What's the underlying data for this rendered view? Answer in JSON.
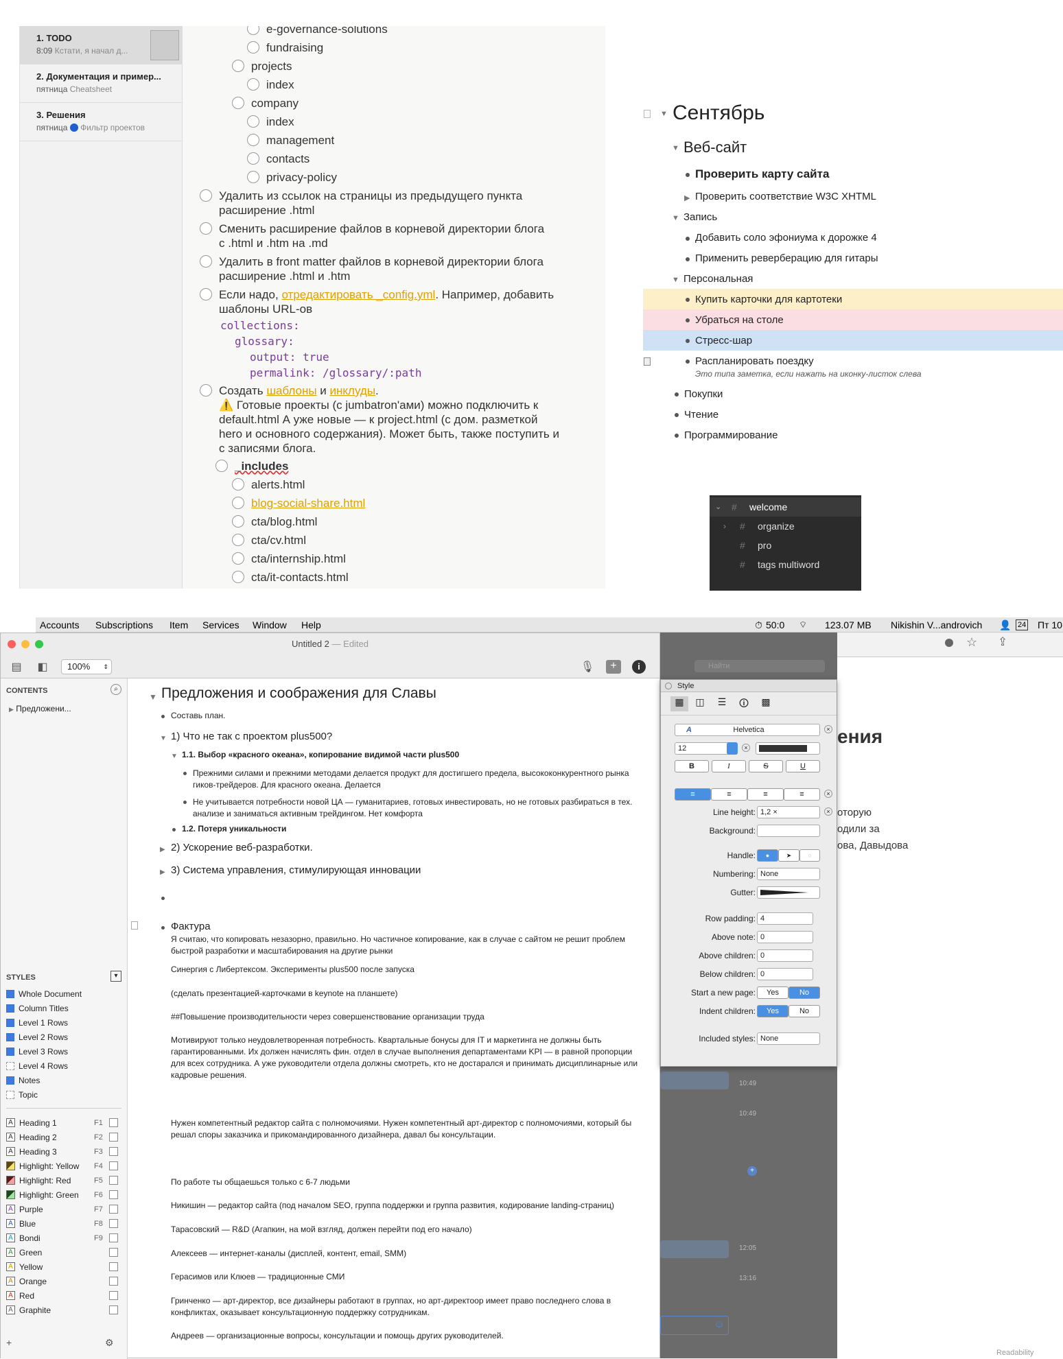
{
  "notes_app": {
    "notes": [
      {
        "title": "1. TODO",
        "date": "8:09",
        "preview": "Кстати, я начал д..."
      },
      {
        "title": "2. Документация и пример...",
        "date": "пятница",
        "preview": "Cheatsheet"
      },
      {
        "title": "3. Решения",
        "date": "пятница",
        "preview": "Фильтр проектов"
      }
    ],
    "tasks": {
      "t1": "e-governance-solutions",
      "t2": "fundraising",
      "t3": "projects",
      "t4": "index",
      "t5": "company",
      "t6": "index",
      "t7": "management",
      "t8": "contacts",
      "t9": "privacy-policy",
      "t10a": "Удалить из ссылок на страницы из предыдущего пункта",
      "t10b": "расширение .html",
      "t11a": "Сменить расширение файлов в корневой директории блога",
      "t11b": "с .html и .htm на .md",
      "t12a": "Удалить в front matter файлов  в корневой директории блога",
      "t12b": "расширение .html и .htm",
      "t13a_pre": "Если надо, ",
      "t13a_link": "отредактировать _config.yml",
      "t13a_post": ". Например, добавить",
      "t13b": "шаблоны URL-ов",
      "code1": "collections:",
      "code2": "glossary:",
      "code3": "output: true",
      "code4": "permalink: /glossary/:path",
      "t14_pre": "Создать ",
      "t14_link1": "шаблоны",
      "t14_mid": " и ",
      "t14_link2": "инклуды",
      "t14_end": ".",
      "warn1": "⚠️ Готовые проекты (с jumbatron'ами) можно подключить к",
      "warn2": "default.html  А уже новые — к project.html (с дом. разметкой",
      "warn3": "hero и основного содержания). Может быть, также поступить и",
      "warn4": "с записями блога.",
      "inc": "_includes",
      "f1": "alerts.html",
      "f2": "blog-social-share.html",
      "f3": "cta/blog.html",
      "f4": "cta/cv.html",
      "f5": "cta/internship.html",
      "f6": "cta/it-contacts.html"
    }
  },
  "outline": {
    "h1": "Сентябрь",
    "h2": "Веб-сайт",
    "i1": "Проверить карту сайта",
    "i2": "Проверить соответствие W3C XHTML",
    "g1": "Запись",
    "i3": "Добавить соло эфониума к дорожке 4",
    "i4": "Применить реверберацию для гитары",
    "g2": "Персональная",
    "i5": "Купить карточки для картотеки",
    "i6": "Убраться на столе",
    "i7": "Стресс-шар",
    "i8": "Распланировать поездку",
    "note": "Это типа заметка, если нажать на иконку-листок слева",
    "g3": "Покупки",
    "g4": "Чтение",
    "g5": "Программирование",
    "colors": {
      "yellow": "#fdf0c8",
      "red": "#fbdde4",
      "blue": "#cfe1f4"
    }
  },
  "tags": {
    "items": [
      "welcome",
      "organize",
      "pro",
      "tags multiword"
    ]
  },
  "menubar": {
    "items": [
      "Accounts",
      "Subscriptions",
      "Item",
      "Services",
      "Window",
      "Help"
    ],
    "timer": "50:0",
    "mem": "123.07 MB",
    "user": "Nikishin V...androvich",
    "cal": "24",
    "clock": "Пт 10"
  },
  "window": {
    "title": "Untitled 2",
    "edited": "— Edited",
    "zoom": "100%",
    "contents_label": "CONTENTS",
    "contents_item": "Предложени...",
    "styles_label": "STYLES",
    "styles": [
      "Whole Document",
      "Column Titles",
      "Level 1 Rows",
      "Level 2 Rows",
      "Level 3 Rows",
      "Level 4 Rows",
      "Notes",
      "Topic"
    ],
    "named_styles": [
      {
        "name": "Heading 1",
        "key": "F1"
      },
      {
        "name": "Heading 2",
        "key": "F2"
      },
      {
        "name": "Heading 3",
        "key": "F3"
      },
      {
        "name": "Highlight: Yellow",
        "key": "F4"
      },
      {
        "name": "Highlight: Red",
        "key": "F5"
      },
      {
        "name": "Highlight: Green",
        "key": "F6"
      },
      {
        "name": "Purple",
        "key": "F7"
      },
      {
        "name": "Blue",
        "key": "F8"
      },
      {
        "name": "Bondi",
        "key": "F9"
      },
      {
        "name": "Green",
        "key": ""
      },
      {
        "name": "Yellow",
        "key": ""
      },
      {
        "name": "Orange",
        "key": ""
      },
      {
        "name": "Red",
        "key": ""
      },
      {
        "name": "Graphite",
        "key": ""
      }
    ]
  },
  "document": {
    "title": "Предложения и соображения для Славы",
    "r1": "Составь план.",
    "r2": "1) Что не так с проектом plus500?",
    "r3": "1.1. Выбор «красного океана», копирование видимой части plus500",
    "r4a": "Прежними силами и прежними методами делается продукт для достигшего предела, высококонкурентного рынка",
    "r4b": "гиков-трейдеров.  Для красного океана. Делается",
    "r5a": "Не учитывается потребности новой ЦА — гуманитариев, готовых инвестировать, но не готовых разбираться в тех.",
    "r5b": "анализе и заниматься активным трейдингом. Нет комфорта",
    "r6": "1.2. Потеря уникальности",
    "r7": "2) Ускорение веб-разработки.",
    "r8": "3) Система управления, стимулирующая инновации",
    "r9": "Фактура",
    "n1a": "Я считаю, что копировать незазорно, правильно. Но частичное копирование, как в случае с сайтом не решит проблем",
    "n1b": "быстрой разработки и масштабирования на другие рынки",
    "n2": "Синергия с Либертексом. Эксперименты plus500 после запуска",
    "n3": "(сделать презентацией-карточками в keynote на планшете)",
    "n4": "##Повышение производительности через совершенствование организации труда",
    "n5a": "Мотивируют только неудовлетворенная потребность. Квартальные бонусы для IT и маркетинга не должны быть",
    "n5b": "гарантированными. Их должен начислять фин. отдел в случае выполнения департаментами KPI — в равной пропорции",
    "n5c": "для всех сотрудника. А уже руководители отдела должны смотреть, кто не достарался и принимать дисциплинарные или",
    "n5d": "кадровые решения.",
    "n6a": "Нужен компетентный редактор сайта с полномочиями. Нужен компетентный арт-директор с полномочиями, который бы",
    "n6b": "решал споры заказчика и прикомандированного дизайнера, давал бы консультации.",
    "n7": "По работе ты общаешься только с 6-7 людьми",
    "n8": "Никишин — редактор сайта (под началом SEO, группа поддержки и группа развития, кодирование landing-страниц)",
    "n9": "Тарасовский — R&D (Агапкин, на мой взгляд, должен перейти под его начало)",
    "n10": "Алексеев — интернет-каналы (дисплей, контент, email, SMM)",
    "n11": "Герасимов или Клюев — традиционные СМИ",
    "n12a": "Гринченко — арт-директор, все дизайнеры работают в группах, но арт-директоор имеет право последнего слова в",
    "n12b": "конфликтах, оказывает консультационную поддержку сотрудникам.",
    "n13": "Андреев — организационные вопросы, консультации и помощь других руководителей."
  },
  "style_panel": {
    "title": "Style",
    "font": "Helvetica",
    "size": "12",
    "bold": "B",
    "italic": "I",
    "strike": "S",
    "underline": "U",
    "line_height_label": "Line height:",
    "line_height": "1,2 ×",
    "background_label": "Background:",
    "handle_label": "Handle:",
    "numbering_label": "Numbering:",
    "numbering": "None",
    "gutter_label": "Gutter:",
    "row_padding_label": "Row padding:",
    "row_padding": "4",
    "above_note_label": "Above note:",
    "above_note": "0",
    "above_children_label": "Above children:",
    "above_children": "0",
    "below_children_label": "Below children:",
    "below_children": "0",
    "new_page_label": "Start a new page:",
    "indent_label": "Indent children:",
    "yes": "Yes",
    "no": "No",
    "included_label": "Included styles:",
    "included": "None"
  },
  "background_window": {
    "search_placeholder": "Найти",
    "heading_fragment": "ения",
    "text1": "оторую",
    "text2": "одили за",
    "text3": "ова, Давыдова",
    "time1": "10:49",
    "time2": "10:49",
    "time3": "12:05",
    "time4": "13:16",
    "readability": "Readability"
  }
}
